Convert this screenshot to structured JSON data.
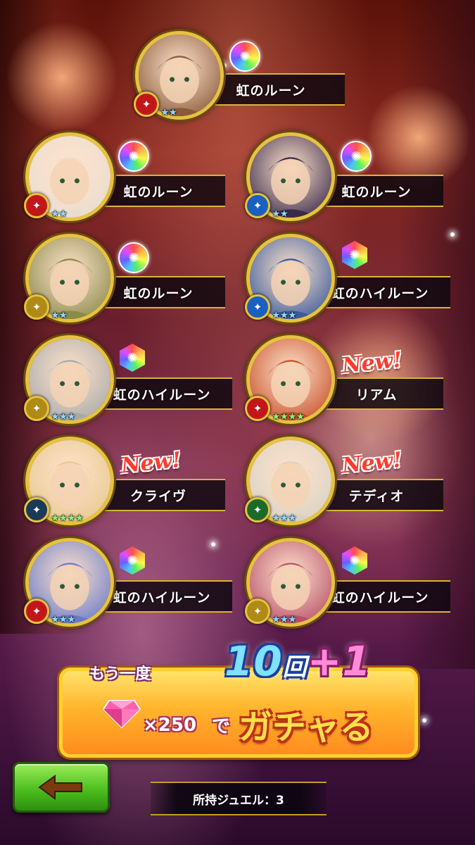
{
  "results": [
    {
      "id": "r1",
      "item_label": "虹のルーン",
      "rune_type": "round",
      "stars": 2,
      "star_color": "blue",
      "role_icon": "dagger-icon",
      "role_color": "#c2171a",
      "is_new": false,
      "portrait_color": "#8a5a3a"
    },
    {
      "id": "r2",
      "item_label": "虹のルーン",
      "rune_type": "round",
      "stars": 2,
      "star_color": "blue",
      "role_icon": "bow-icon",
      "role_color": "#c2171a",
      "is_new": false,
      "portrait_color": "#e9ddd0"
    },
    {
      "id": "r3",
      "item_label": "虹のルーン",
      "rune_type": "round",
      "stars": 2,
      "star_color": "blue",
      "role_icon": "axe-icon",
      "role_color": "#1a5fc2",
      "is_new": false,
      "portrait_color": "#3a2a4a"
    },
    {
      "id": "r4",
      "item_label": "虹のルーン",
      "rune_type": "round",
      "stars": 2,
      "star_color": "blue",
      "role_icon": "fist-icon",
      "role_color": "#b08a16",
      "is_new": false,
      "portrait_color": "#8a8a4a"
    },
    {
      "id": "r5",
      "item_label": "虹のハイルーン",
      "rune_type": "hex",
      "stars": 3,
      "star_color": "blue",
      "role_icon": "axe-icon",
      "role_color": "#1a5fc2",
      "is_new": false,
      "portrait_color": "#3a5a9a"
    },
    {
      "id": "r6",
      "item_label": "虹のハイルーン",
      "rune_type": "hex",
      "stars": 3,
      "star_color": "blue",
      "role_icon": "fist-icon",
      "role_color": "#b08a16",
      "is_new": false,
      "portrait_color": "#a9a9a9"
    },
    {
      "id": "r7",
      "item_label": "リアム",
      "rune_type": null,
      "stars": 4,
      "star_color": "green",
      "role_icon": "sword-icon",
      "role_color": "#c2171a",
      "is_new": true,
      "portrait_color": "#c8502a"
    },
    {
      "id": "r8",
      "item_label": "クライヴ",
      "rune_type": null,
      "stars": 4,
      "star_color": "green",
      "role_icon": "star-burst-icon",
      "role_color": "#1a3a5a",
      "is_new": true,
      "portrait_color": "#e8c890"
    },
    {
      "id": "r9",
      "item_label": "テディオ",
      "rune_type": null,
      "stars": 3,
      "star_color": "blue",
      "role_icon": "leaf-icon",
      "role_color": "#1a6a2a",
      "is_new": true,
      "portrait_color": "#d9d2c4"
    },
    {
      "id": "r10",
      "item_label": "虹のハイルーン",
      "rune_type": "hex",
      "stars": 3,
      "star_color": "blue",
      "role_icon": "dagger-icon",
      "role_color": "#c2171a",
      "is_new": false,
      "portrait_color": "#6a7ac8"
    },
    {
      "id": "r11",
      "item_label": "虹のハイルーン",
      "rune_type": "hex",
      "stars": 3,
      "star_color": "blue",
      "role_icon": "fist-icon",
      "role_color": "#b08a16",
      "is_new": false,
      "portrait_color": "#b8506a"
    }
  ],
  "new_label": "New!",
  "gacha": {
    "once_label": "もう一度",
    "count_main": "10",
    "count_unit": "回",
    "count_bonus": "+1",
    "cost_label": "×250",
    "de_label": "で",
    "action_label": "ガチャる"
  },
  "footer": {
    "jewel_text": "所持ジュエル：3",
    "back_icon": "back-arrow-icon"
  }
}
